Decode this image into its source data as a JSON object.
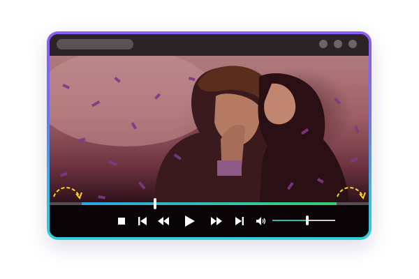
{
  "player": {
    "progress_fraction": 0.33,
    "volume_fraction": 0.56,
    "accent_colors": {
      "frame_top": "#8b5cf6",
      "frame_bottom": "#2fd0d9",
      "progress": "#2fc9a8",
      "hint_arrow": "#ffd21f"
    },
    "controls": [
      {
        "name": "stop-button",
        "icon": "stop-icon"
      },
      {
        "name": "previous-button",
        "icon": "skip-previous-icon"
      },
      {
        "name": "rewind-button",
        "icon": "rewind-icon"
      },
      {
        "name": "play-button",
        "icon": "play-icon"
      },
      {
        "name": "fast-forward-button",
        "icon": "fast-forward-icon"
      },
      {
        "name": "next-button",
        "icon": "skip-next-icon"
      },
      {
        "name": "volume-button",
        "icon": "speaker-icon"
      }
    ],
    "hints": [
      "curved-arrow-icon",
      "curved-arrow-icon"
    ]
  }
}
